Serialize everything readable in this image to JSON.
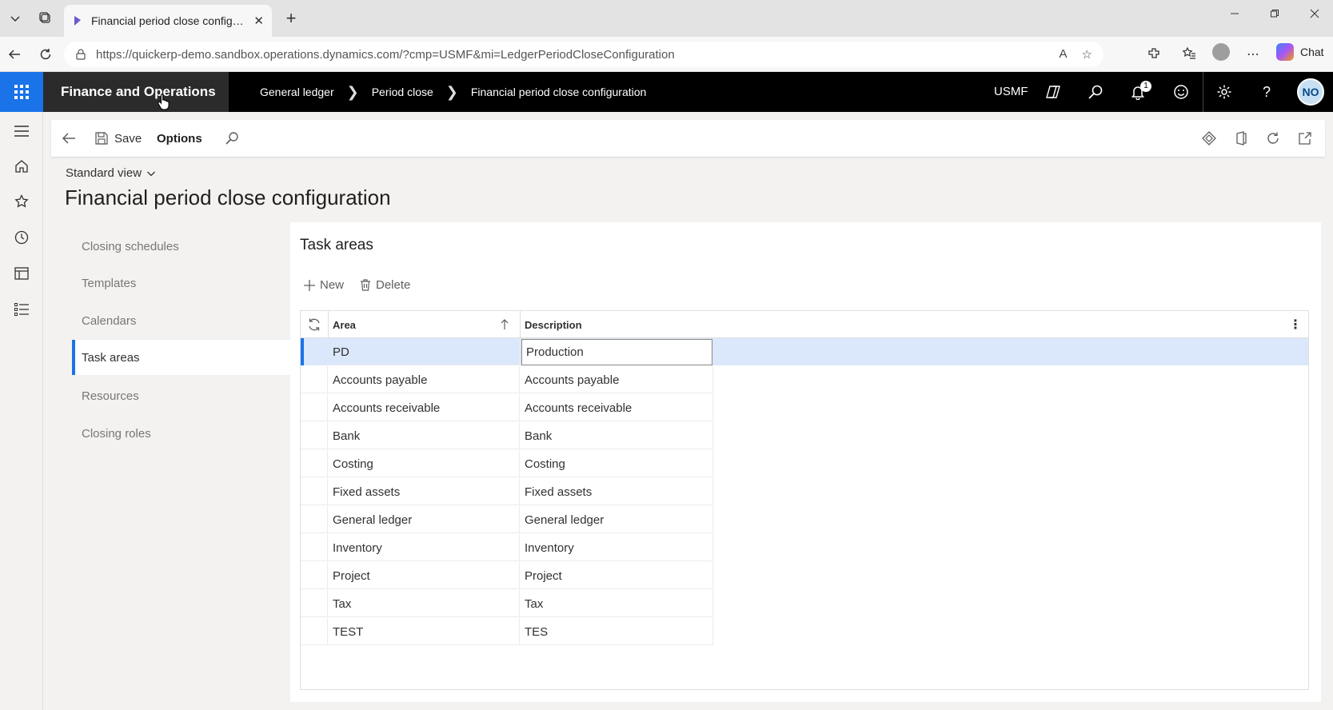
{
  "browser": {
    "tab_title": "Financial period close configuration",
    "tab_close": "✕",
    "new_tab": "+",
    "url": "https://quickerp-demo.sandbox.operations.dynamics.com/?cmp=USMF&mi=LedgerPeriodCloseConfiguration",
    "read_aloud": "A",
    "chat_label": "Chat"
  },
  "appbar": {
    "app_name": "Finance and Operations",
    "breadcrumbs": [
      "General ledger",
      "Period close",
      "Financial period close configuration"
    ],
    "company": "USMF",
    "notification_count": "1",
    "user_initials": "NO"
  },
  "actionpane": {
    "save_label": "Save",
    "options_label": "Options"
  },
  "view": {
    "selector_label": "Standard view",
    "page_title": "Financial period close configuration"
  },
  "vnav": {
    "items": [
      "Closing schedules",
      "Templates",
      "Calendars",
      "Task areas",
      "Resources",
      "Closing roles"
    ],
    "active_index": 3
  },
  "panel": {
    "title": "Task areas",
    "new_label": "New",
    "delete_label": "Delete"
  },
  "grid": {
    "columns": [
      "Area",
      "Description"
    ],
    "rows": [
      {
        "area": "PD",
        "description": "Production"
      },
      {
        "area": "Accounts payable",
        "description": "Accounts payable"
      },
      {
        "area": "Accounts receivable",
        "description": "Accounts receivable"
      },
      {
        "area": "Bank",
        "description": "Bank"
      },
      {
        "area": "Costing",
        "description": "Costing"
      },
      {
        "area": "Fixed assets",
        "description": "Fixed assets"
      },
      {
        "area": "General ledger",
        "description": "General ledger"
      },
      {
        "area": "Inventory",
        "description": "Inventory"
      },
      {
        "area": "Project",
        "description": "Project"
      },
      {
        "area": "Tax",
        "description": "Tax"
      },
      {
        "area": "TEST",
        "description": "TES"
      }
    ],
    "selected_index": 0
  },
  "colors": {
    "accent": "#1a73e8",
    "appbar_bg": "#000000",
    "selected_row": "#dbe7fb"
  }
}
